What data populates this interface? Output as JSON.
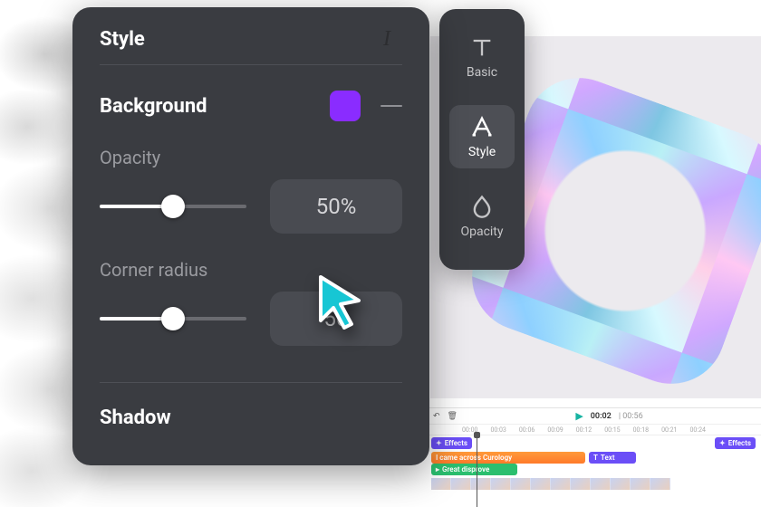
{
  "rail": {
    "items": [
      {
        "id": "basic",
        "label": "Basic"
      },
      {
        "id": "style",
        "label": "Style"
      },
      {
        "id": "opacity",
        "label": "Opacity"
      }
    ],
    "active": "style"
  },
  "panel": {
    "title": "Style",
    "italic_glyph": "I",
    "background": {
      "label": "Background",
      "color": "#8a2cff"
    },
    "opacity": {
      "label": "Opacity",
      "value": 50,
      "display": "50%",
      "slider_pct": 50
    },
    "corner_radius": {
      "label": "Corner radius",
      "value": 50,
      "display": "50",
      "slider_pct": 50
    },
    "shadow": {
      "label": "Shadow"
    }
  },
  "timeline": {
    "play_glyph": "▶",
    "current": "00:02",
    "duration": "00:56",
    "ruler": [
      "00:00",
      "00:03",
      "00:06",
      "00:09",
      "00:12",
      "00:15",
      "00:18",
      "00:21",
      "00:24"
    ],
    "chips": {
      "effects1": "Effects",
      "effects2": "Effects",
      "text": "Text"
    },
    "clips": {
      "caption": "I came across Curology",
      "green": "Great  disprove"
    }
  }
}
